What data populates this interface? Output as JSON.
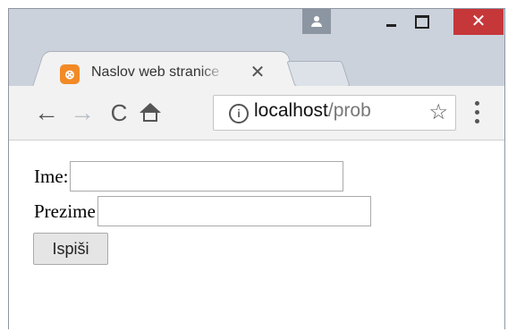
{
  "tab": {
    "title": "Naslov web stranice",
    "close_glyph": "✕",
    "favicon_glyph": "⊗"
  },
  "window_controls": {
    "close_glyph": "✕"
  },
  "toolbar": {
    "back_glyph": "←",
    "forward_glyph": "→",
    "reload_glyph": "C",
    "info_glyph": "i",
    "url_host": "localhost",
    "url_path": "/prob",
    "star_glyph": "☆"
  },
  "form": {
    "first_name_label": "Ime:",
    "first_name_value": "",
    "last_name_label": "Prezime",
    "last_name_value": "",
    "submit_label": "Ispiši"
  },
  "colors": {
    "window_close": "#c6373a",
    "favicon": "#f28a26"
  }
}
